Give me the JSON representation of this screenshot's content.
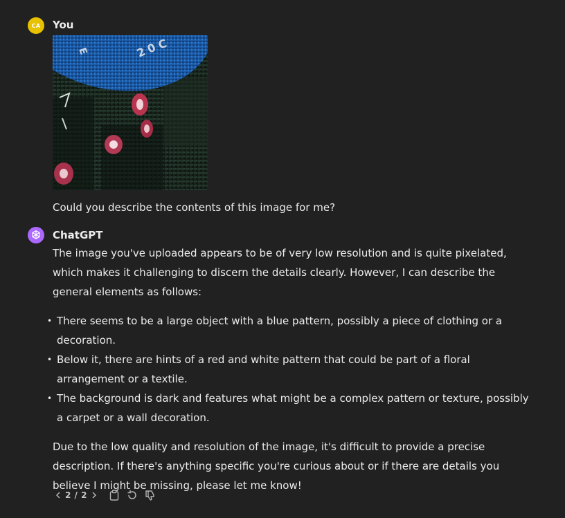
{
  "user": {
    "initials": "CA",
    "name": "You",
    "message": "Could you describe the contents of this image for me?"
  },
  "assistant": {
    "name": "ChatGPT",
    "intro": "The image you've uploaded appears to be of very low resolution and is quite pixelated, which makes it challenging to discern the details clearly. However, I can describe the general elements as follows:",
    "bullets": [
      "There seems to be a large object with a blue pattern, possibly a piece of clothing or a decoration.",
      "Below it, there are hints of a red and white pattern that could be part of a floral arrangement or a textile.",
      "The background is dark and features what might be a complex pattern or texture, possibly a carpet or a wall decoration."
    ],
    "closing": "Due to the low quality and resolution of the image, it's difficult to provide a precise description. If there's anything specific you're curious about or if there are details you believe I might be missing, please let me know!"
  },
  "actions": {
    "counter": "2 / 2",
    "prev_icon": "chevron-left-icon",
    "next_icon": "chevron-right-icon",
    "copy_icon": "clipboard-icon",
    "regenerate_icon": "regenerate-icon",
    "dislike_icon": "thumbs-down-icon"
  },
  "colors": {
    "background": "#212121",
    "text": "#ececec",
    "user_avatar": "#e8c100",
    "assistant_avatar": "#ab68ff",
    "muted": "#b4b4b4"
  }
}
